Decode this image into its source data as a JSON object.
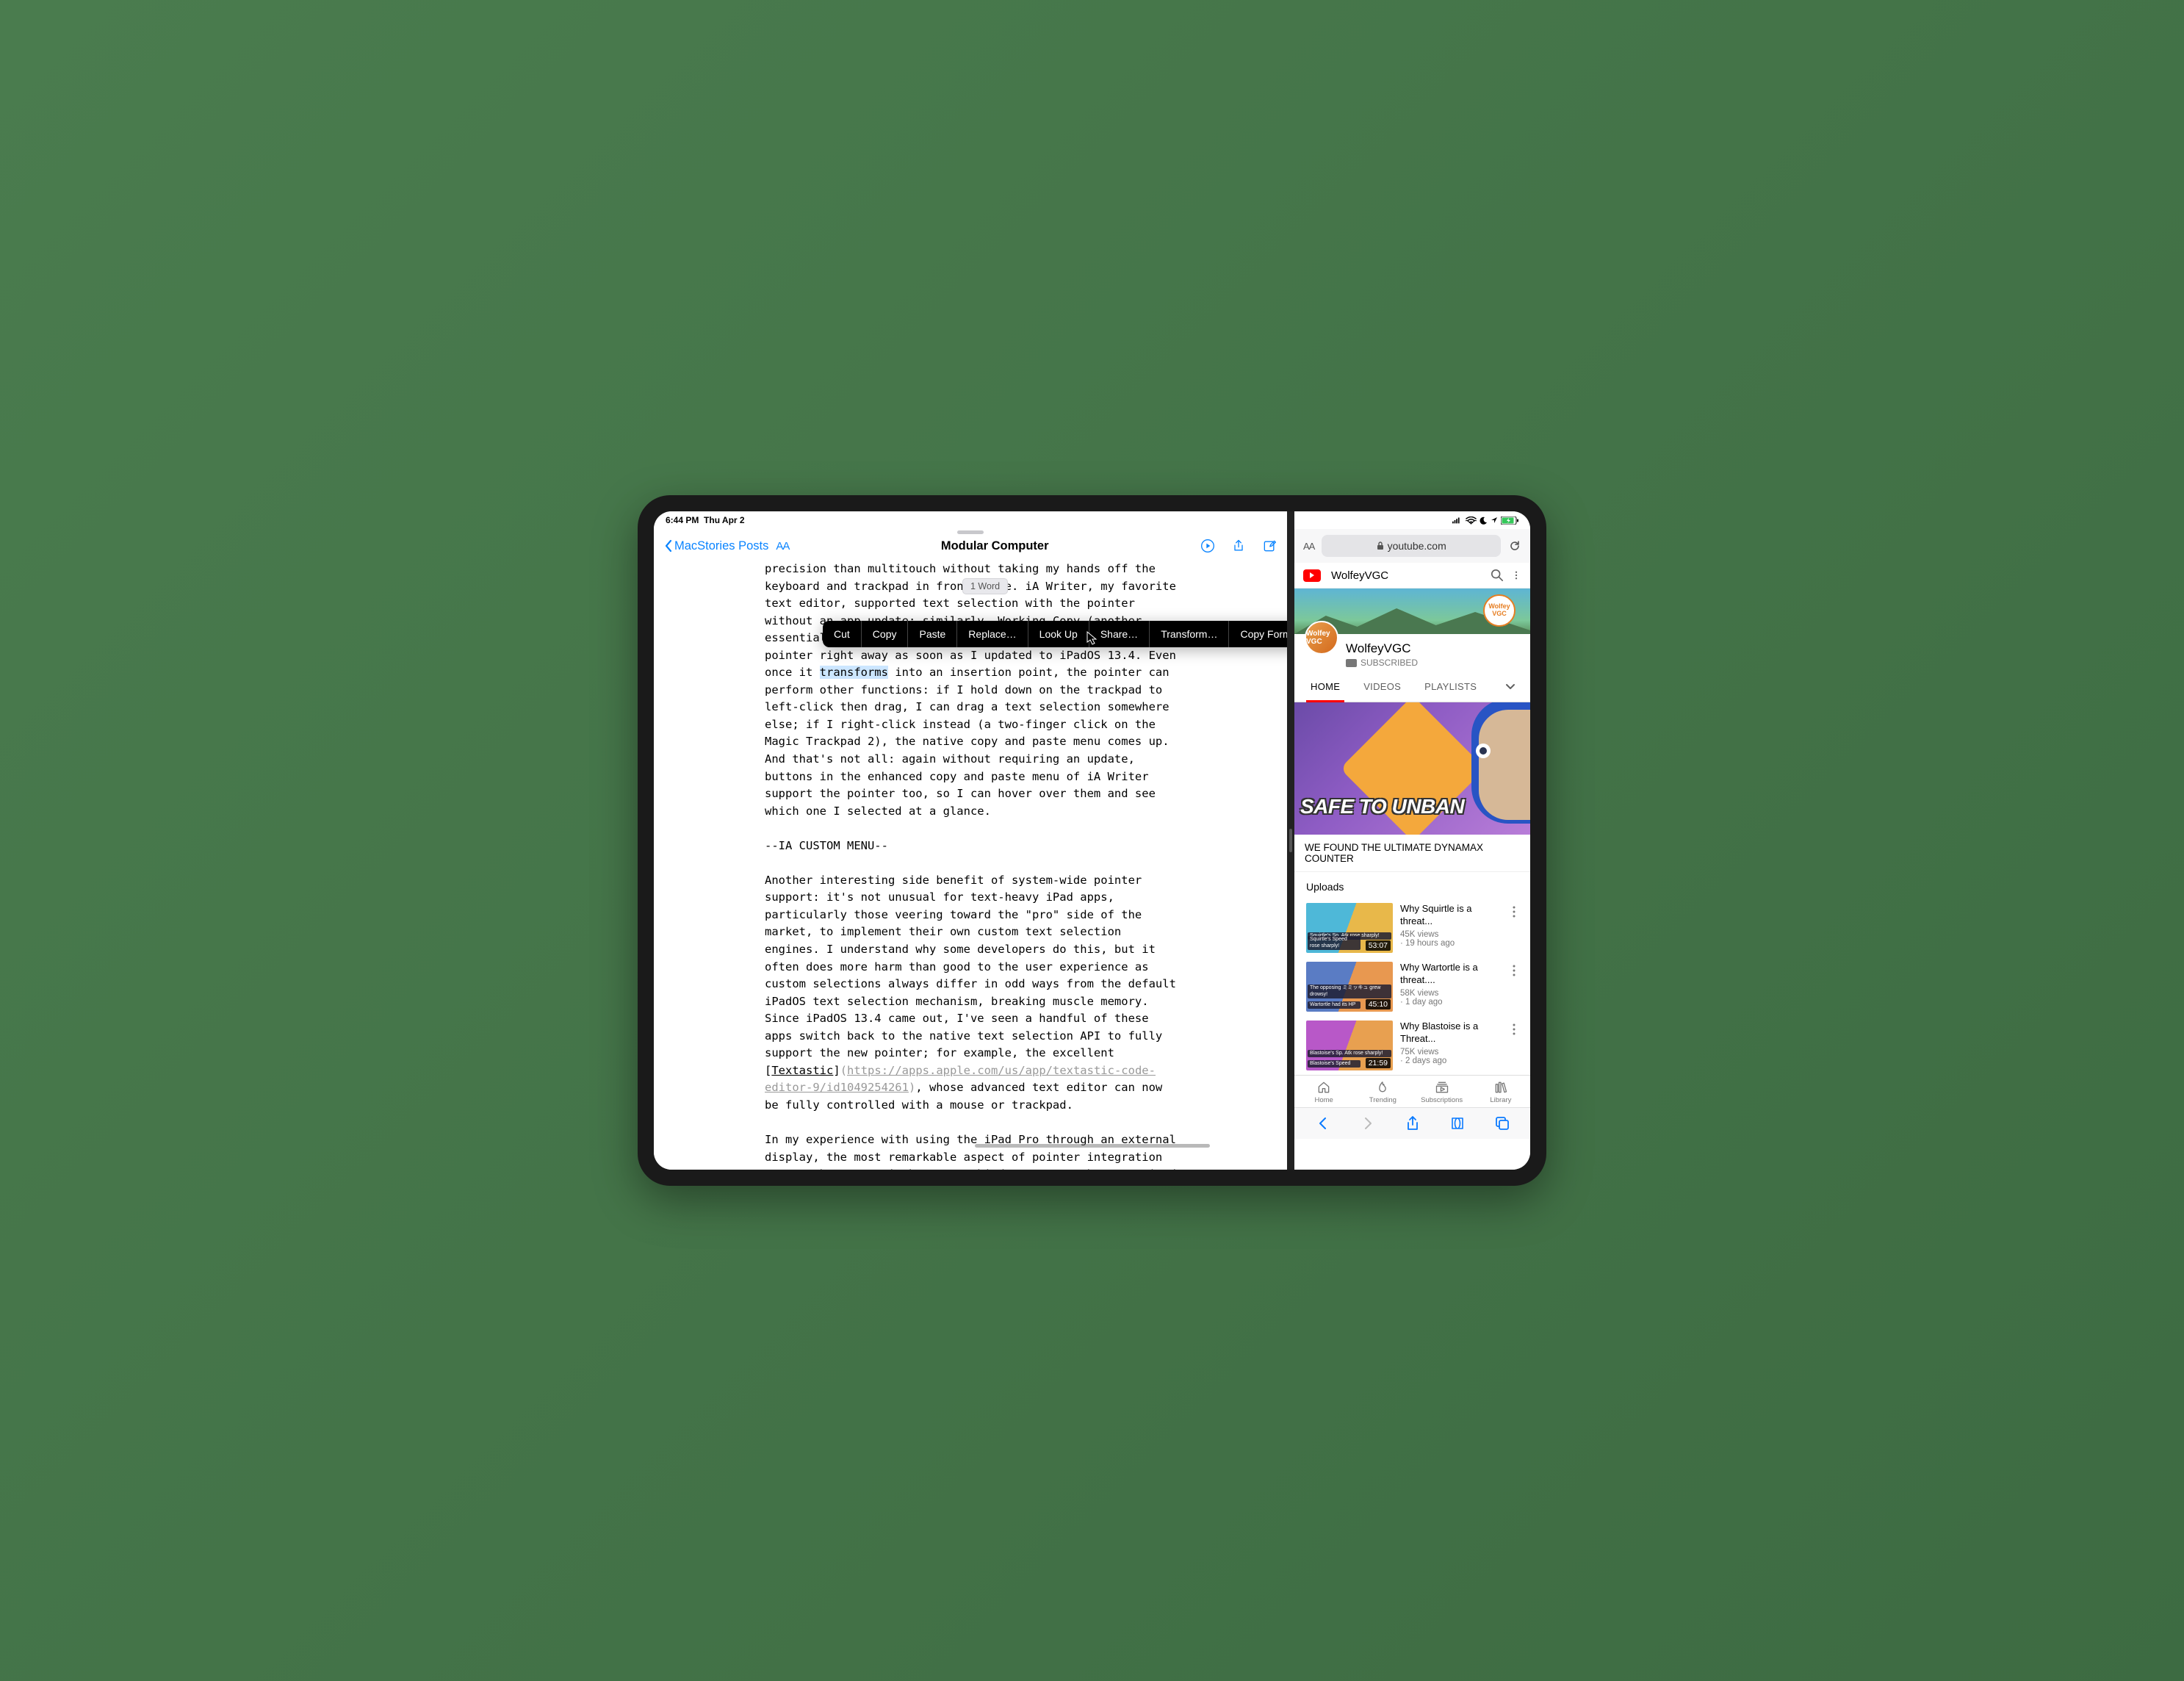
{
  "status_bar": {
    "time": "6:44 PM",
    "date": "Thu Apr 2"
  },
  "editor": {
    "back_label": "MacStories Posts",
    "title": "Modular Computer",
    "tooltip": "1 Word",
    "context_menu": [
      "Cut",
      "Copy",
      "Paste",
      "Replace…",
      "Look Up",
      "Share…",
      "Transform…",
      "Copy Formatted"
    ],
    "body": {
      "p1a": "precision than multitouch without taking my hands off the keyboard and trackpad in front of me. iA Writer, my favorite text editor, supported text selection with the pointer without an app update; similarly, Working Copy (another essential tool I also use on a daily basis) worked with the pointer right away as soon as I updated to iPadOS 13.4. Even once it ",
      "p1_sel": "transforms",
      "p1b": " into an insertion point, the pointer can perform other functions: if I hold down on the trackpad to left-click then drag, I can drag a text selection somewhere else; if I right-click instead (a two-finger click on the Magic Trackpad 2), the native copy and paste menu comes up. And that's not all: again without requiring an update, buttons in the enhanced copy and paste menu of iA Writer support the pointer too, so I can hover over them and see which one I selected at a glance.",
      "p2": "--IA CUSTOM MENU--",
      "p3a": "Another interesting side benefit of system-wide pointer support: it's not unusual for text-heavy iPad apps, particularly those veering toward the \"pro\" side of the market, to implement their own custom text selection engines. I understand why some developers do this, but it often does more harm than good to the user experience as custom selections always differ in odd ways from the default iPadOS text selection mechanism, breaking muscle memory. Since iPadOS 13.4 came out, I've seen a handful of these apps switch back to the native text selection API to fully support the new pointer; for example, the excellent ",
      "link_text": "Textastic",
      "link_url": "https://apps.apple.com/us/app/textastic-code-editor-9/id1049254261",
      "p3b": ", whose advanced text editor can now be fully controlled with a mouse or trackpad.",
      "p4": "In my experience with using the iPad Pro through an external display, the most remarkable aspect of pointer integration across the system is how many third-party apps have received"
    }
  },
  "safari": {
    "url": "youtube.com"
  },
  "youtube": {
    "header_title": "WolfeyVGC",
    "channel_name": "WolfeyVGC",
    "subscribed_label": "SUBSCRIBED",
    "banner_badge": "Wolfey VGC",
    "tabs": [
      "HOME",
      "VIDEOS",
      "PLAYLISTS"
    ],
    "feature_overlay": "SAFE TO UNBAN",
    "feature_title": "WE FOUND THE ULTIMATE DYNAMAX COUNTER",
    "uploads_label": "Uploads",
    "videos": [
      {
        "title": "Why Squirtle is a threat...",
        "views": "45K views",
        "age": "19 hours ago",
        "duration": "53:07",
        "tag1": "Squirtle's Sp. Atk rose sharply!",
        "tag2": "Squirtle's Speed rose sharply!"
      },
      {
        "title": "Why Wartortle is a threat....",
        "views": "58K views",
        "age": "1 day ago",
        "duration": "45:10",
        "tag1": "The opposing ミミッキュ grew drowsy!",
        "tag2": "Wartortle had its HP"
      },
      {
        "title": "Why Blastoise is a Threat...",
        "views": "75K views",
        "age": "2 days ago",
        "duration": "21:59",
        "tag1": "Blastoise's Sp. Atk rose sharply!",
        "tag2": "Blastoise's Speed"
      }
    ],
    "bottom_nav": [
      "Home",
      "Trending",
      "Subscriptions",
      "Library"
    ]
  }
}
